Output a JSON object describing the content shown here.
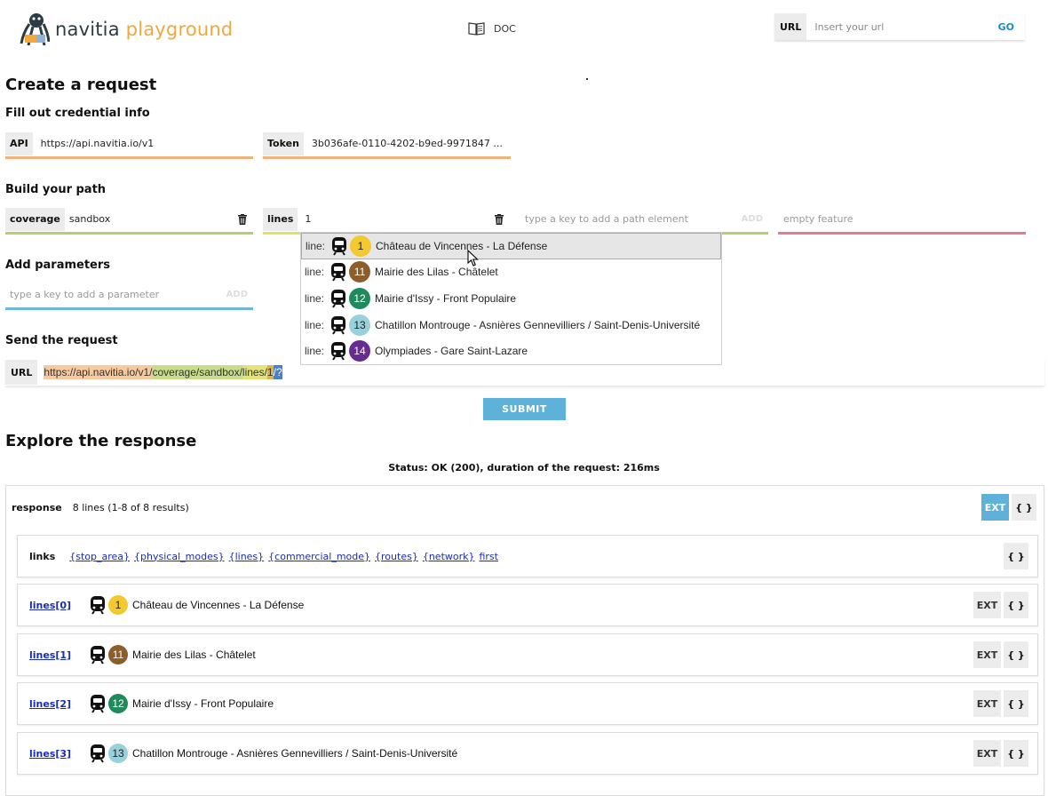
{
  "header": {
    "logo_part1": "navitia",
    "logo_part2": "playground",
    "doc_label": "DOC",
    "url_tag": "URL",
    "url_placeholder": "Insert your url",
    "go_label": "GO"
  },
  "create": {
    "title": "Create a request",
    "credential_heading": "Fill out credential info",
    "api_label": "API",
    "api_value": "https://api.navitia.io/v1",
    "token_label": "Token",
    "token_value": "3b036afe-0110-4202-b9ed-9971847 ..."
  },
  "path": {
    "heading": "Build your path",
    "coverage_label": "coverage",
    "coverage_value": "sandbox",
    "lines_label": "lines",
    "lines_value": "1",
    "path_placeholder": "type a key to add a path element",
    "add_label": "ADD",
    "feature_placeholder": "empty feature"
  },
  "params": {
    "heading": "Add parameters",
    "placeholder": "type a key to add a parameter",
    "add_label": "ADD"
  },
  "dropdown": {
    "prefix": "line:",
    "items": [
      {
        "code": "1",
        "name": "Château de Vincennes - La Défense",
        "color": "#f2c930",
        "text": "#222222"
      },
      {
        "code": "11",
        "name": "Mairie des Lilas - Châtelet",
        "color": "#8d5e2a",
        "text": "#ffffff"
      },
      {
        "code": "12",
        "name": "Mairie d'Issy - Front Populaire",
        "color": "#1f8a5c",
        "text": "#ffffff"
      },
      {
        "code": "13",
        "name": "Chatillon Montrouge - Asnières Gennevilliers / Saint-Denis-Université",
        "color": "#98d0dc",
        "text": "#222222"
      },
      {
        "code": "14",
        "name": "Olympiades - Gare Saint-Lazare",
        "color": "#662c91",
        "text": "#ffffff"
      }
    ]
  },
  "send": {
    "heading": "Send the request",
    "url_label": "URL",
    "url_parts": [
      "https://api.navitia.io/v1/",
      "coverage/sandbox/",
      "lines/",
      "1",
      "/?"
    ],
    "submit_label": "SUBMIT"
  },
  "explore": {
    "title": "Explore the response",
    "status": "Status: OK (200), duration of the request: 216ms",
    "response_label": "response",
    "response_summary": "8 lines (1-8 of 8 results)",
    "ext_label": "EXT",
    "brace_label": "{ }",
    "links_label": "links",
    "links": [
      "{stop_area}",
      "{physical_modes}",
      "{lines}",
      "{commercial_mode}",
      "{routes}",
      "{network}",
      "first"
    ],
    "lines": [
      {
        "key": "lines[0]",
        "code": "1",
        "name": "Château de Vincennes - La Défense",
        "color": "#f2c930",
        "text": "#222222"
      },
      {
        "key": "lines[1]",
        "code": "11",
        "name": "Mairie des Lilas - Châtelet",
        "color": "#8d5e2a",
        "text": "#ffffff"
      },
      {
        "key": "lines[2]",
        "code": "12",
        "name": "Mairie d'Issy - Front Populaire",
        "color": "#1f8a5c",
        "text": "#ffffff"
      },
      {
        "key": "lines[3]",
        "code": "13",
        "name": "Chatillon Montrouge - Asnières Gennevilliers / Saint-Denis-Université",
        "color": "#98d0dc",
        "text": "#222222"
      }
    ]
  },
  "colors": {
    "api_underline": "#f0b27a",
    "coverage_underline": "#b5cf6b",
    "lines_underline": "#e2e25b",
    "feature_underline": "#e87a8c",
    "params_underline": "#6fb6e0",
    "accent": "#5eb1d8"
  }
}
